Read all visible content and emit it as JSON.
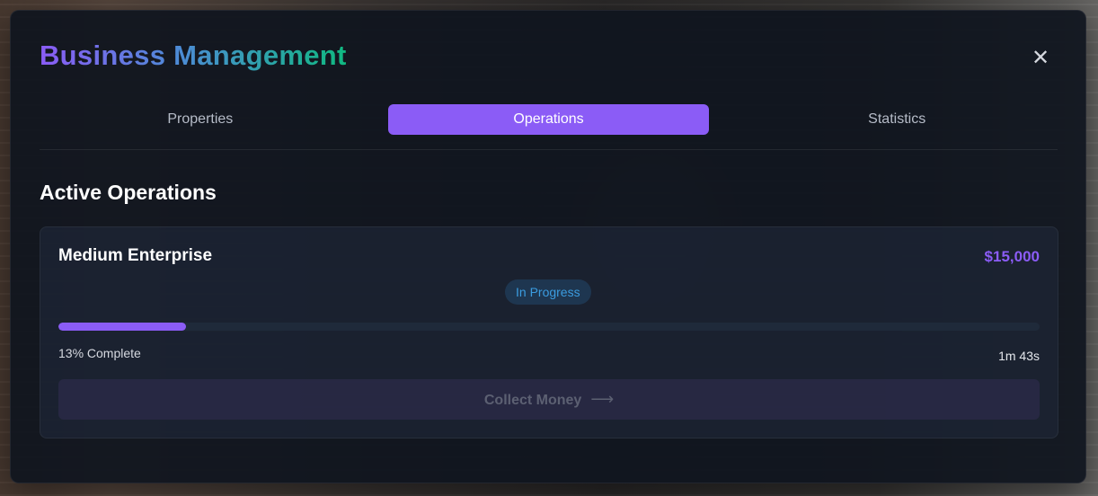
{
  "app": {
    "title": "Business Management",
    "close_glyph": "✕"
  },
  "tabs": [
    {
      "label": "Properties",
      "active": false
    },
    {
      "label": "Operations",
      "active": true
    },
    {
      "label": "Statistics",
      "active": false
    }
  ],
  "section": {
    "title": "Active Operations"
  },
  "operation": {
    "name": "Medium Enterprise",
    "amount": "$15,000",
    "status": "In Progress",
    "progress": 0.13,
    "progress_label": "13% Complete",
    "time_remaining": "1m 43s",
    "collect_label": "Collect Money",
    "collect_arrow": "⟶"
  },
  "colors": {
    "accent": "#8b5cf6",
    "status": "#3b9ce0",
    "title_gradient_end": "#10b981"
  }
}
